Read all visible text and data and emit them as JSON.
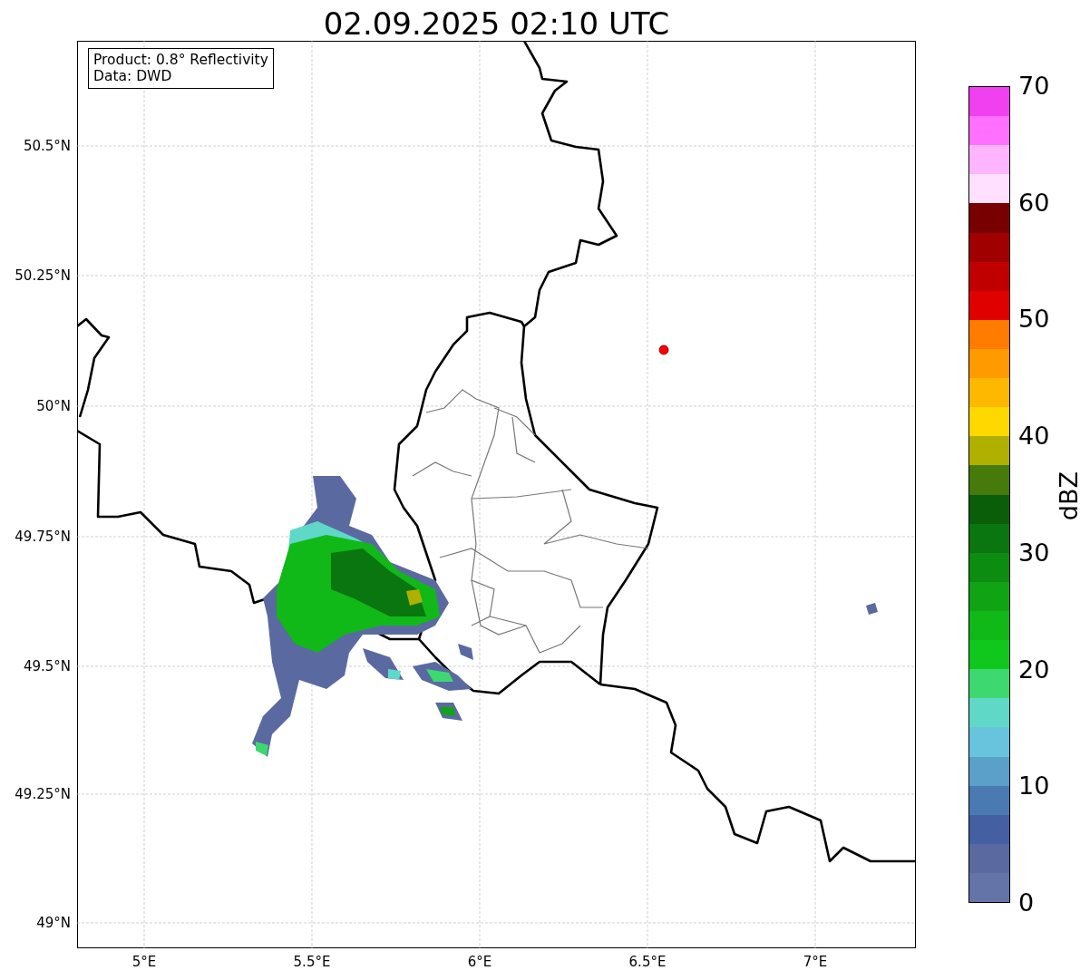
{
  "title": "02.09.2025 02:10 UTC",
  "info_box": [
    "Product: 0.8° Reflectivity",
    "Data: DWD"
  ],
  "map": {
    "lat_ticks": [
      "50.5°N",
      "50.25°N",
      "50°N",
      "49.75°N",
      "49.5°N",
      "49.25°N",
      "49°N"
    ],
    "lon_ticks": [
      "5°E",
      "5.5°E",
      "6°E",
      "6.5°E",
      "7°E"
    ]
  },
  "colorbar": {
    "label": "dBZ",
    "ticks": [
      "70",
      "60",
      "50",
      "40",
      "30",
      "20",
      "10",
      "0"
    ],
    "bins": [
      {
        "color": "#f040f0"
      },
      {
        "color": "#ff70ff"
      },
      {
        "color": "#ffb4ff"
      },
      {
        "color": "#ffe0ff"
      },
      {
        "color": "#780000"
      },
      {
        "color": "#a00000"
      },
      {
        "color": "#c00000"
      },
      {
        "color": "#e00000"
      },
      {
        "color": "#ff7c00"
      },
      {
        "color": "#ff9a00"
      },
      {
        "color": "#ffb800"
      },
      {
        "color": "#ffd800"
      },
      {
        "color": "#b0b000"
      },
      {
        "color": "#467a0a"
      },
      {
        "color": "#0a5e0a"
      },
      {
        "color": "#0a7610"
      },
      {
        "color": "#0c8c10"
      },
      {
        "color": "#10a414"
      },
      {
        "color": "#10b818"
      },
      {
        "color": "#10c81c"
      },
      {
        "color": "#3ed870"
      },
      {
        "color": "#60d8c8"
      },
      {
        "color": "#68c4dc"
      },
      {
        "color": "#5aa0c8"
      },
      {
        "color": "#4a7ab2"
      },
      {
        "color": "#4460a2"
      },
      {
        "color": "#5a6aa0"
      },
      {
        "color": "#6474a8"
      }
    ]
  }
}
